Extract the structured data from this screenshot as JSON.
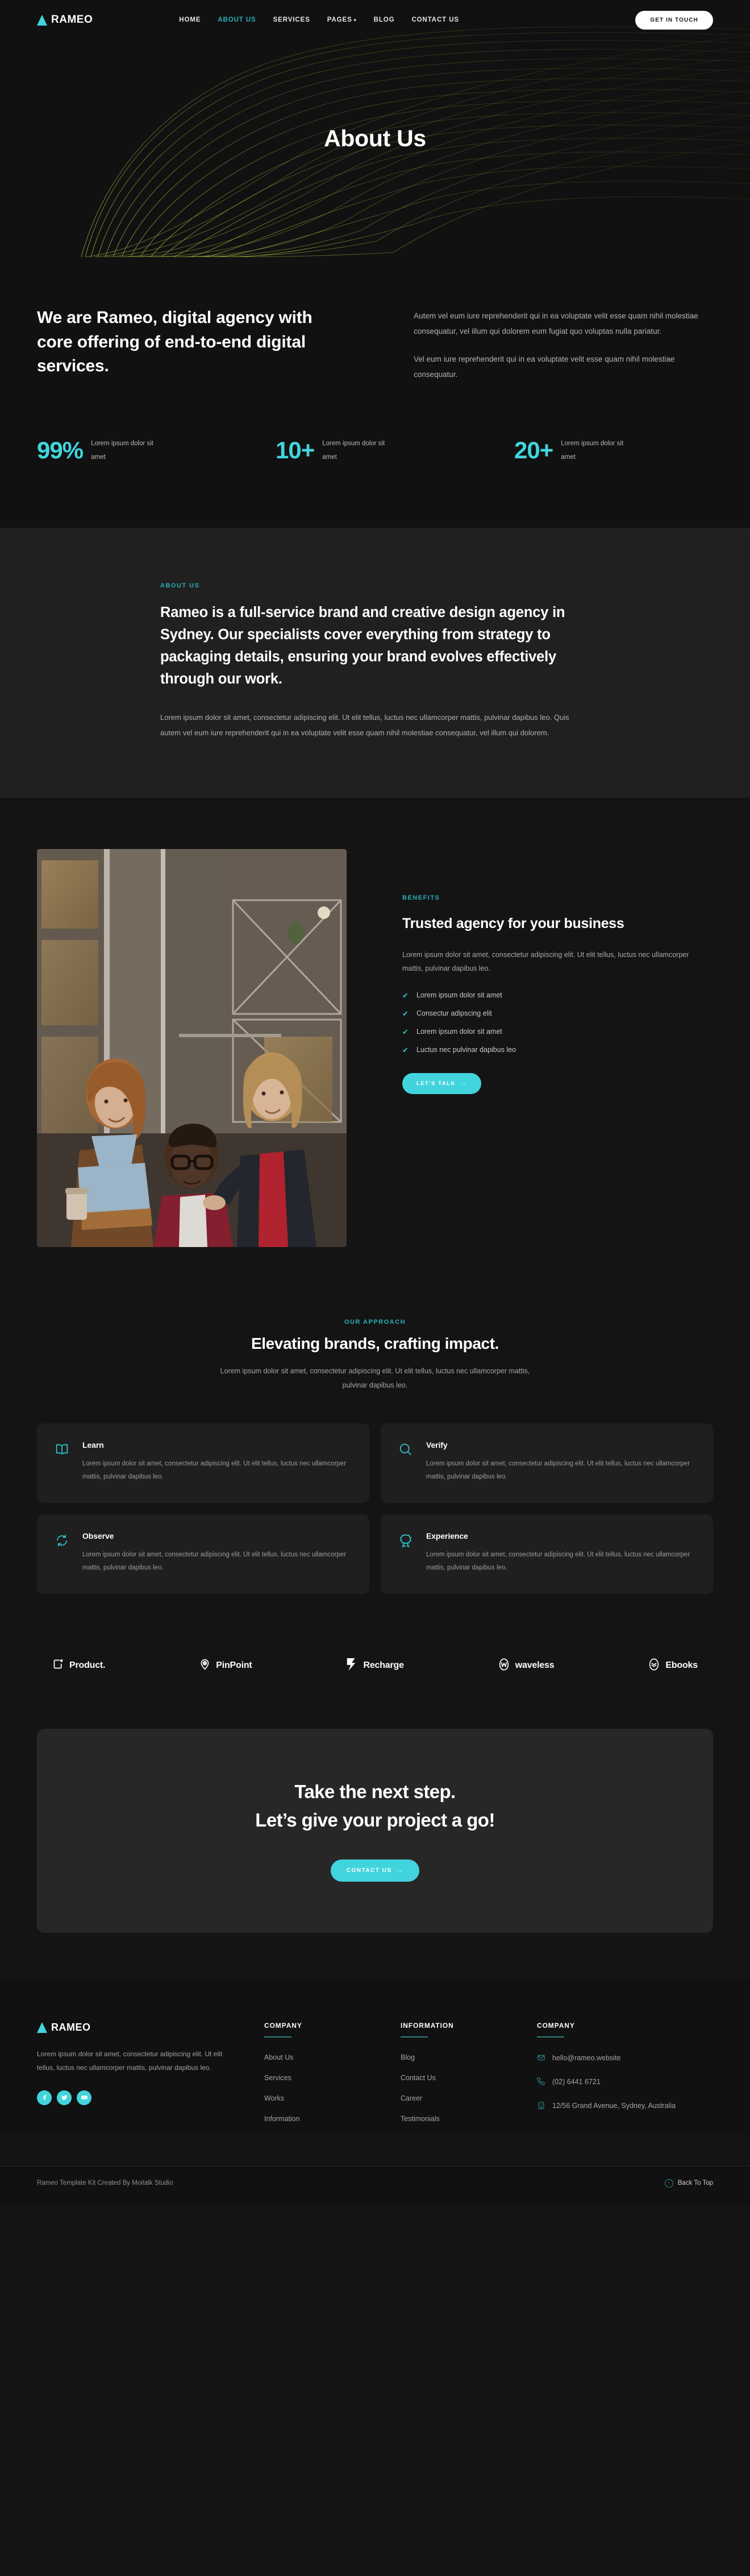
{
  "header": {
    "logo_text": "RAMEO",
    "nav": [
      {
        "label": "HOME",
        "active": false
      },
      {
        "label": "ABOUT US",
        "active": true
      },
      {
        "label": "SERVICES",
        "active": false
      },
      {
        "label": "PAGES",
        "active": false,
        "caret": true
      },
      {
        "label": "BLOG",
        "active": false
      },
      {
        "label": "CONTACT US",
        "active": false
      }
    ],
    "cta_label": "GET IN TOUCH"
  },
  "hero": {
    "title": "About Us"
  },
  "intro": {
    "heading": "We are Rameo, digital agency with core offering of end-to-end digital services.",
    "paragraph1": "Autem vel eum iure reprehenderit qui in ea voluptate velit esse quam nihil molestiae consequatur, vel illum qui dolorem eum fugiat quo voluptas nulla pariatur.",
    "paragraph2": "Vel eum iure reprehenderit qui in ea voluptate velit esse quam nihil molestiae consequatur."
  },
  "stats": [
    {
      "value": "99%",
      "label": "Lorem ipsum dolor sit amet"
    },
    {
      "value": "10+",
      "label": "Lorem ipsum dolor sit amet"
    },
    {
      "value": "20+",
      "label": "Lorem ipsum dolor sit amet"
    }
  ],
  "about": {
    "eyebrow": "ABOUT US",
    "heading": "Rameo is a full-service brand and creative design agency in Sydney. Our specialists cover everything from strategy to packaging details, ensuring your brand evolves effectively through our work.",
    "body": "Lorem ipsum dolor sit amet, consectetur adipiscing elit. Ut elit tellus, luctus nec ullamcorper mattis, pulvinar dapibus leo. Quis autem vel eum iure reprehenderit qui in ea voluptate velit esse quam nihil molestiae consequatur, vel illum qui dolorem."
  },
  "benefits": {
    "eyebrow": "BENEFITS",
    "heading": "Trusted agency for your business",
    "body": "Lorem ipsum dolor sit amet, consectetur adipiscing elit. Ut elit tellus, luctus nec ullamcorper mattis, pulvinar dapibus leo.",
    "checks": [
      "Lorem ipsum dolor sit amet",
      "Consectur adipscing elit",
      "Lorem ipsum dolor sit amet",
      "Luctus nec pulvinar dapibus leo"
    ],
    "button_label": "LET'S TALK",
    "photo_alt": "team photo"
  },
  "approach": {
    "eyebrow": "OUR APPROACH",
    "heading": "Elevating brands, crafting impact.",
    "body": "Lorem ipsum dolor sit amet, consectetur adipiscing elit. Ut elit tellus, luctus nec ullamcorper mattis, pulvinar dapibus leo.",
    "cards": [
      {
        "icon": "book-icon",
        "title": "Learn",
        "body": "Lorem ipsum dolor sit amet, consectetur adipiscing elit. Ut elit tellus, luctus nec ullamcorper mattis, pulvinar dapibus leo."
      },
      {
        "icon": "magnifier-icon",
        "title": "Verify",
        "body": "Lorem ipsum dolor sit amet, consectetur adipiscing elit. Ut elit tellus, luctus nec ullamcorper mattis, pulvinar dapibus leo."
      },
      {
        "icon": "refresh-icon",
        "title": "Observe",
        "body": "Lorem ipsum dolor sit amet, consectetur adipiscing elit. Ut elit tellus, luctus nec ullamcorper mattis, pulvinar dapibus leo."
      },
      {
        "icon": "award-icon",
        "title": "Experience",
        "body": "Lorem ipsum dolor sit amet, consectetur adipiscing elit. Ut elit tellus, luctus nec ullamcorper mattis, pulvinar dapibus leo."
      }
    ]
  },
  "brands": [
    {
      "name": "Product.",
      "icon": "product-icon"
    },
    {
      "name": "PinPoint",
      "icon": "pinpoint-icon"
    },
    {
      "name": "Recharge",
      "icon": "recharge-icon"
    },
    {
      "name": "waveless",
      "icon": "waveless-icon"
    },
    {
      "name": "Ebooks",
      "icon": "ebooks-icon"
    }
  ],
  "cta": {
    "line1": "Take the next step.",
    "line2": "Let’s give your project a go!",
    "button_label": "CONTACT US"
  },
  "footer": {
    "logo_text": "RAMEO",
    "description": "Lorem ipsum dolor sit amet, consectetur adipiscing elit. Ut elit tellus, luctus nec ullamcorper mattis, pulvinar dapibus leo.",
    "socials": [
      {
        "name": "facebook-icon"
      },
      {
        "name": "twitter-icon"
      },
      {
        "name": "youtube-icon"
      }
    ],
    "columns": [
      {
        "title": "COMPANY",
        "links": [
          "About Us",
          "Services",
          "Works",
          "Information"
        ]
      },
      {
        "title": "INFORMATION",
        "links": [
          "Blog",
          "Contact Us",
          "Career",
          "Testimonials"
        ]
      }
    ],
    "contact": {
      "title": "COMPANY",
      "items": [
        {
          "icon": "mail-icon",
          "text": "hello@rameo.website"
        },
        {
          "icon": "phone-icon",
          "text": "(02) 6441 6721"
        },
        {
          "icon": "building-icon",
          "text": "12/56 Grand Avenue, Sydney, Australia"
        }
      ]
    },
    "bottom_left": "Rameo Template Kit Created By Moitalk Studio",
    "back_to_top": "Back To Top"
  },
  "colors": {
    "accent": "#42d4dd",
    "accent_dark": "#2aafb9",
    "bg": "#141414",
    "bg_alt": "#202020",
    "hero_bg": "#111111",
    "mesh": "#7e8a2e"
  }
}
